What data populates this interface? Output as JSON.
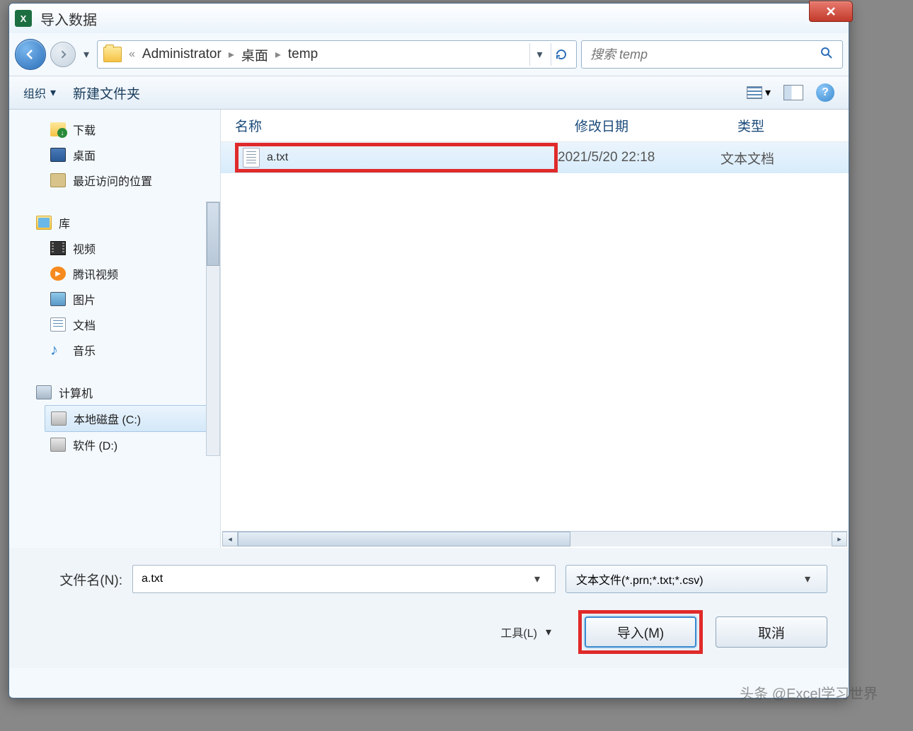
{
  "title": "导入数据",
  "breadcrumb": {
    "user": "Administrator",
    "desktop": "桌面",
    "folder": "temp"
  },
  "search": {
    "placeholder": "搜索 temp"
  },
  "toolbar": {
    "organize": "组织",
    "newfolder": "新建文件夹"
  },
  "tree": {
    "downloads": "下载",
    "desktop": "桌面",
    "recent": "最近访问的位置",
    "library": "库",
    "video": "视频",
    "tencent": "腾讯视频",
    "pictures": "图片",
    "documents": "文档",
    "music": "音乐",
    "computer": "计算机",
    "diskC": "本地磁盘 (C:)",
    "diskD": "软件 (D:)"
  },
  "columns": {
    "name": "名称",
    "date": "修改日期",
    "type": "类型"
  },
  "file": {
    "name": "a.txt",
    "date": "2021/5/20 22:18",
    "type": "文本文档"
  },
  "footer": {
    "filename_label": "文件名(N):",
    "filename_value": "a.txt",
    "filetype": "文本文件(*.prn;*.txt;*.csv)",
    "tools": "工具(L)",
    "import": "导入(M)",
    "cancel": "取消"
  },
  "watermark": "头条 @Excel学习世界"
}
